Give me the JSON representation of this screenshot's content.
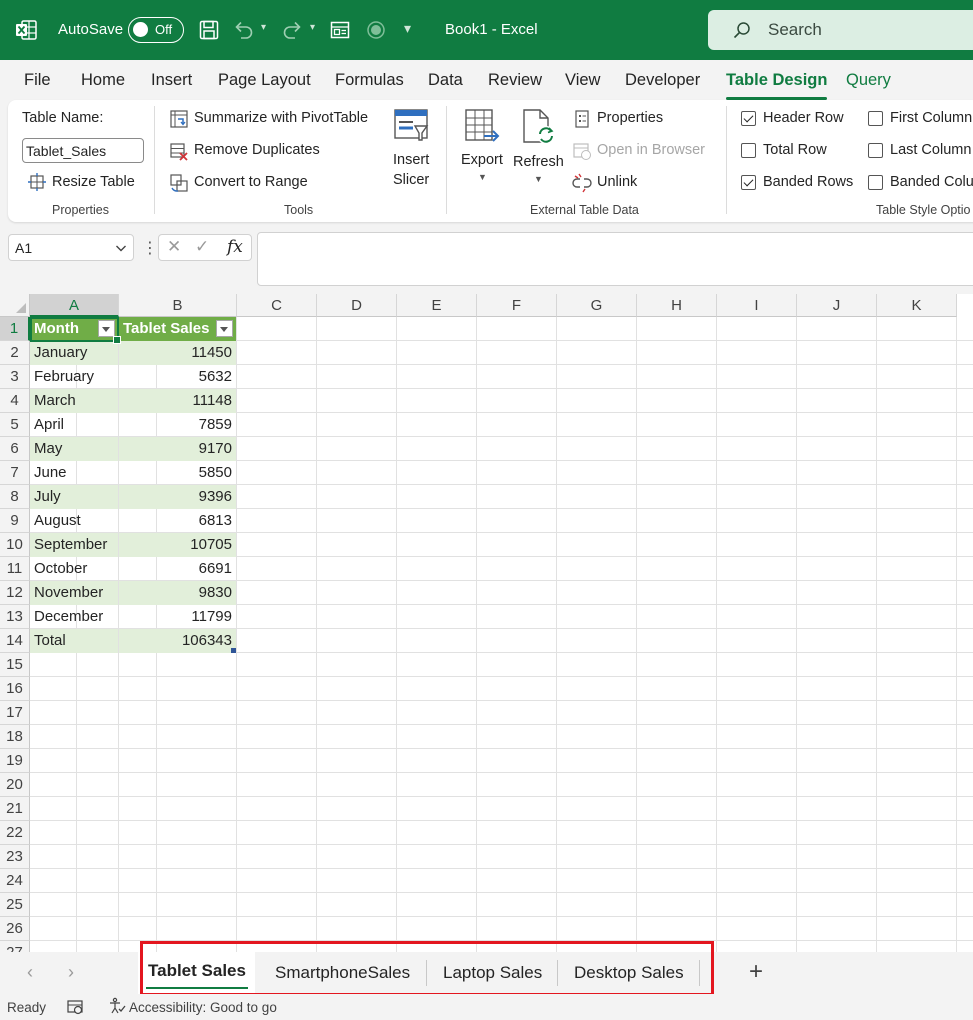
{
  "titlebar": {
    "autosave_label": "AutoSave",
    "autosave_state": "Off",
    "doc_title": "Book1  -  Excel",
    "search_placeholder": "Search"
  },
  "ribbon_tabs": [
    "File",
    "Home",
    "Insert",
    "Page Layout",
    "Formulas",
    "Data",
    "Review",
    "View",
    "Developer",
    "Table Design",
    "Query"
  ],
  "active_ribbon_tab": "Table Design",
  "ribbon": {
    "properties": {
      "table_name_label": "Table Name:",
      "table_name_value": "Tablet_Sales",
      "resize_table": "Resize Table",
      "group_label": "Properties"
    },
    "tools": {
      "summarize": "Summarize with PivotTable",
      "remove_duplicates": "Remove Duplicates",
      "convert_to_range": "Convert to Range",
      "insert_slicer_line1": "Insert",
      "insert_slicer_line2": "Slicer",
      "group_label": "Tools"
    },
    "external": {
      "export": "Export",
      "refresh": "Refresh",
      "properties": "Properties",
      "open_in_browser": "Open in Browser",
      "unlink": "Unlink",
      "group_label": "External Table Data"
    },
    "style_options": {
      "header_row": "Header Row",
      "total_row": "Total Row",
      "banded_rows": "Banded Rows",
      "first_column": "First Column",
      "last_column": "Last Column",
      "banded_columns": "Banded Colu",
      "header_row_checked": true,
      "total_row_checked": false,
      "banded_rows_checked": true,
      "first_column_checked": false,
      "last_column_checked": false,
      "banded_columns_checked": false,
      "group_label": "Table Style Optio"
    }
  },
  "formula_bar": {
    "name_box": "A1",
    "cancel_glyph": "✕",
    "enter_glyph": "✓",
    "fx": "fx",
    "formula": ""
  },
  "columns": [
    "A",
    "B",
    "C",
    "D",
    "E",
    "F",
    "G",
    "H",
    "I",
    "J",
    "K"
  ],
  "rows": [
    "1",
    "2",
    "3",
    "4",
    "5",
    "6",
    "7",
    "8",
    "9",
    "10",
    "11",
    "12",
    "13",
    "14",
    "15",
    "16",
    "17",
    "18",
    "19",
    "20",
    "21",
    "22",
    "23",
    "24",
    "25",
    "26",
    "27"
  ],
  "table": {
    "headers": [
      "Month",
      "Tablet Sales"
    ],
    "rows": [
      [
        "January",
        "11450"
      ],
      [
        "February",
        "5632"
      ],
      [
        "March",
        "11148"
      ],
      [
        "April",
        "7859"
      ],
      [
        "May",
        "9170"
      ],
      [
        "June",
        "5850"
      ],
      [
        "July",
        "9396"
      ],
      [
        "August",
        "6813"
      ],
      [
        "September",
        "10705"
      ],
      [
        "October",
        "6691"
      ],
      [
        "November",
        "9830"
      ],
      [
        "December",
        "11799"
      ]
    ],
    "total": [
      "Total",
      "106343"
    ]
  },
  "sheet_tabs": [
    "Tablet Sales",
    "SmartphoneSales",
    "Laptop Sales",
    "Desktop Sales"
  ],
  "active_sheet": "Tablet Sales",
  "add_sheet_glyph": "+",
  "status": {
    "ready": "Ready",
    "accessibility": "Accessibility: Good to go"
  },
  "colors": {
    "excel_green": "#107c41",
    "table_header": "#70ad47",
    "band": "#e2efda",
    "highlight": "#e3161f"
  }
}
